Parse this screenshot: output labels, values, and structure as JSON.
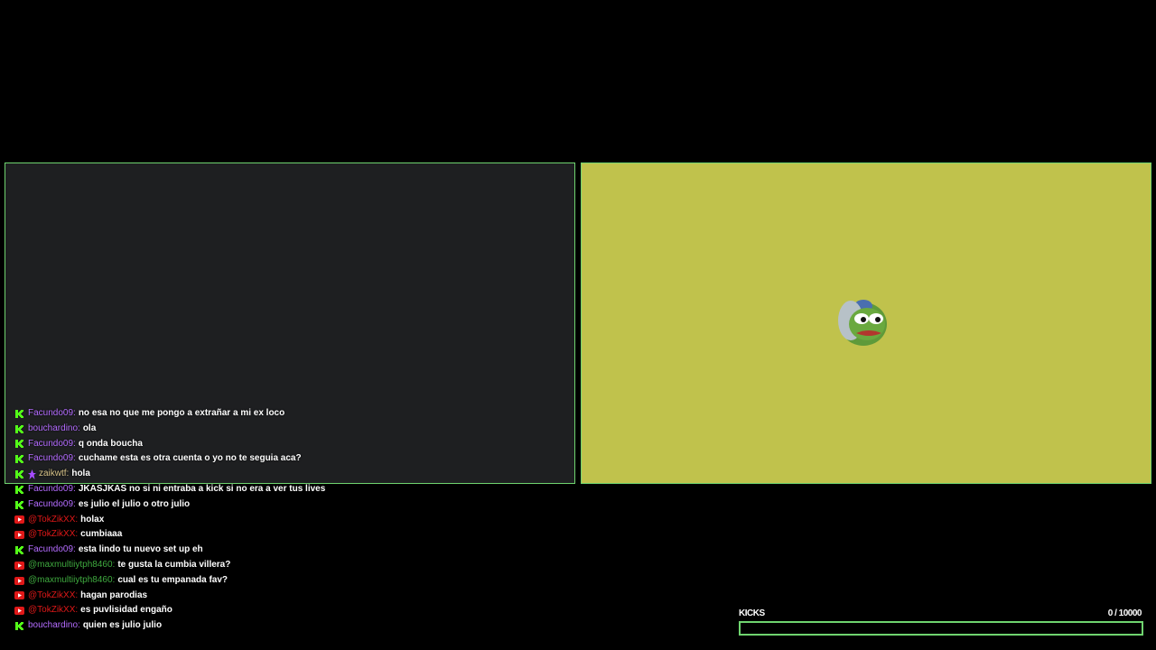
{
  "colors": {
    "accent_green": "#6fd46f",
    "kick_user": "#b46cff",
    "youtube_user": "#e01818",
    "youtube_user_alt": "#3faa3f",
    "sub_user": "#d8c48a",
    "right_panel_bg": "#c0c24c",
    "left_panel_bg": "#1e1f21"
  },
  "panels": {
    "right": {
      "image_icon": "pepe-frog-icon"
    }
  },
  "chat": {
    "messages": [
      {
        "platform": "kick",
        "user": "Facundo09:",
        "color": "#b46cff",
        "text": "no esa no que me pongo a extrañar a mi ex loco"
      },
      {
        "platform": "kick",
        "user": "bouchardino:",
        "color": "#b46cff",
        "text": "ola"
      },
      {
        "platform": "kick",
        "user": "Facundo09:",
        "color": "#b46cff",
        "text": "q onda boucha"
      },
      {
        "platform": "kick",
        "user": "Facundo09:",
        "color": "#b46cff",
        "text": "cuchame esta es otra cuenta o yo no te seguia aca?"
      },
      {
        "platform": "kick",
        "user": "zaikwtf:",
        "color": "#d8c48a",
        "text": "hola",
        "badge": "sub-badge-icon"
      },
      {
        "platform": "kick",
        "user": "Facundo09:",
        "color": "#b46cff",
        "text": "JKASJKAS no si ni entraba a kick si no era a ver tus lives"
      },
      {
        "platform": "kick",
        "user": "Facundo09:",
        "color": "#b46cff",
        "text": "es julio el julio o otro julio"
      },
      {
        "platform": "youtube",
        "user": "@TokZikXX:",
        "color": "#e01818",
        "text": "holax"
      },
      {
        "platform": "youtube",
        "user": "@TokZikXX:",
        "color": "#e01818",
        "text": "cumbiaaa"
      },
      {
        "platform": "kick",
        "user": "Facundo09:",
        "color": "#b46cff",
        "text": "esta lindo tu nuevo set up eh"
      },
      {
        "platform": "youtube",
        "user": "@maxmultiiytph8460:",
        "color": "#3faa3f",
        "text": "te gusta la cumbia villera?"
      },
      {
        "platform": "youtube",
        "user": "@maxmultiiytph8460:",
        "color": "#3faa3f",
        "text": "cual es tu empanada fav?"
      },
      {
        "platform": "youtube",
        "user": "@TokZikXX:",
        "color": "#e01818",
        "text": "hagan parodias"
      },
      {
        "platform": "youtube",
        "user": "@TokZikXX:",
        "color": "#e01818",
        "text": "es puvlisidad engaño"
      },
      {
        "platform": "kick",
        "user": "bouchardino:",
        "color": "#b46cff",
        "text": "quien es julio julio"
      }
    ]
  },
  "kicks_goal": {
    "label": "KICKS",
    "current": 0,
    "count_text": "0  / 10000",
    "progress": 0
  }
}
